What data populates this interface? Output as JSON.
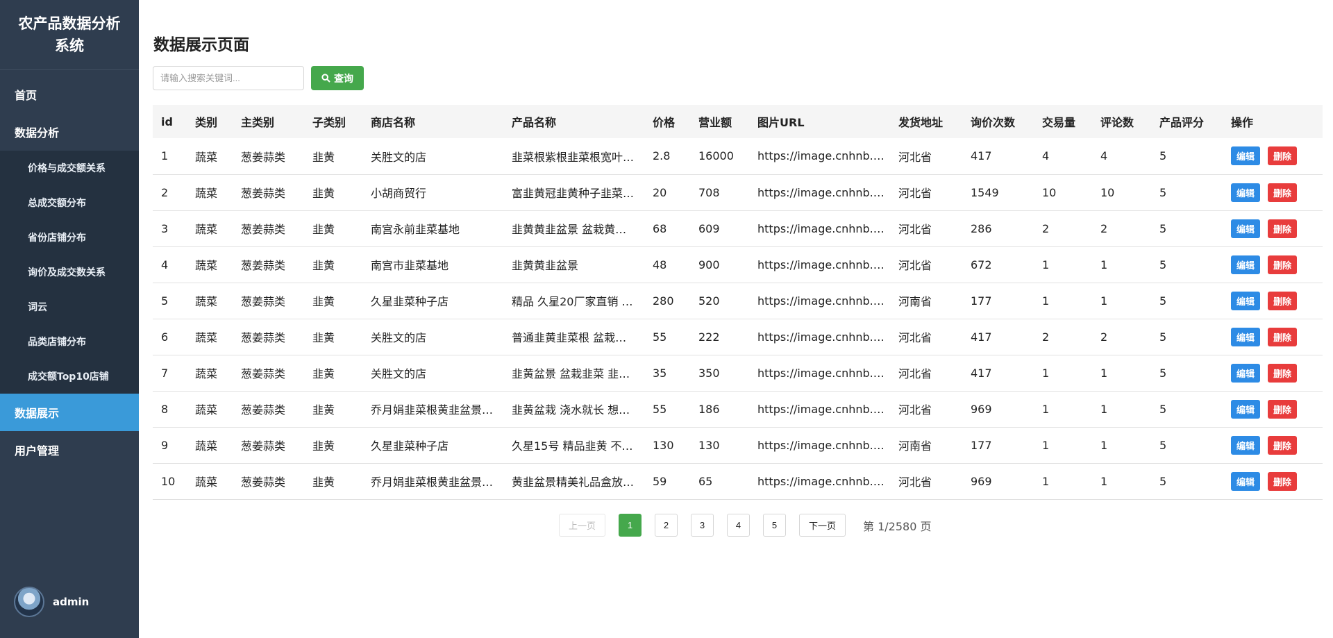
{
  "app": {
    "title": "农产品数据分析系统"
  },
  "sidebar": {
    "items": [
      {
        "label": "首页"
      },
      {
        "label": "数据分析"
      },
      {
        "label": "价格与成交额关系"
      },
      {
        "label": "总成交额分布"
      },
      {
        "label": "省份店铺分布"
      },
      {
        "label": "询价及成交数关系"
      },
      {
        "label": "词云"
      },
      {
        "label": "品类店铺分布"
      },
      {
        "label": "成交额Top10店铺"
      },
      {
        "label": "数据展示"
      },
      {
        "label": "用户管理"
      }
    ],
    "active": "数据展示",
    "user": {
      "name": "admin",
      "avatar_icon": "user-avatar-icon"
    }
  },
  "main": {
    "title": "数据展示页面",
    "search": {
      "placeholder": "请输入搜索关键词..."
    },
    "query_button": {
      "label": "查询",
      "icon": "search-icon"
    },
    "table": {
      "headers": [
        "id",
        "类别",
        "主类别",
        "子类别",
        "商店名称",
        "产品名称",
        "价格",
        "营业额",
        "图片URL",
        "发货地址",
        "询价次数",
        "交易量",
        "评论数",
        "产品评分",
        "操作"
      ],
      "rows": [
        [
          "1",
          "蔬菜",
          "葱姜蒜类",
          "韭黄",
          "关胜文的店",
          "韭菜根紫根韭菜根宽叶…",
          "2.8",
          "16000",
          "https://image.cnhnb.…",
          "河北省",
          "417",
          "4",
          "4",
          "5"
        ],
        [
          "2",
          "蔬菜",
          "葱姜蒜类",
          "韭黄",
          "小胡商贸行",
          "富韭黄冠韭黄种子韭菜…",
          "20",
          "708",
          "https://image.cnhnb.…",
          "河北省",
          "1549",
          "10",
          "10",
          "5"
        ],
        [
          "3",
          "蔬菜",
          "葱姜蒜类",
          "韭黄",
          "南宫永前韭菜基地",
          "韭黄黄韭盆景 盆栽黄…",
          "68",
          "609",
          "https://image.cnhnb.…",
          "河北省",
          "286",
          "2",
          "2",
          "5"
        ],
        [
          "4",
          "蔬菜",
          "葱姜蒜类",
          "韭黄",
          "南宫市韭菜基地",
          "韭黄黄韭盆景",
          "48",
          "900",
          "https://image.cnhnb.…",
          "河北省",
          "672",
          "1",
          "1",
          "5"
        ],
        [
          "5",
          "蔬菜",
          "葱姜蒜类",
          "韭黄",
          "久星韭菜种子店",
          "精品 久星20厂家直销 …",
          "280",
          "520",
          "https://image.cnhnb.…",
          "河南省",
          "177",
          "1",
          "1",
          "5"
        ],
        [
          "6",
          "蔬菜",
          "葱姜蒜类",
          "韭黄",
          "关胜文的店",
          "普通韭黄韭菜根 盆栽…",
          "55",
          "222",
          "https://image.cnhnb.…",
          "河北省",
          "417",
          "2",
          "2",
          "5"
        ],
        [
          "7",
          "蔬菜",
          "葱姜蒜类",
          "韭黄",
          "关胜文的店",
          "韭黄盆景 盆栽韭菜 韭…",
          "35",
          "350",
          "https://image.cnhnb.…",
          "河北省",
          "417",
          "1",
          "1",
          "5"
        ],
        [
          "8",
          "蔬菜",
          "葱姜蒜类",
          "韭黄",
          "乔月娟韭菜根黄韭盆景…",
          "韭黄盆栽 浇水就长 想…",
          "55",
          "186",
          "https://image.cnhnb.…",
          "河北省",
          "969",
          "1",
          "1",
          "5"
        ],
        [
          "9",
          "蔬菜",
          "葱姜蒜类",
          "韭黄",
          "久星韭菜种子店",
          "久星15号 精品韭黄 不…",
          "130",
          "130",
          "https://image.cnhnb.…",
          "河南省",
          "177",
          "1",
          "1",
          "5"
        ],
        [
          "10",
          "蔬菜",
          "葱姜蒜类",
          "韭黄",
          "乔月娟韭菜根黄韭盆景…",
          "黄韭盆景精美礼品盒放…",
          "59",
          "65",
          "https://image.cnhnb.…",
          "河北省",
          "969",
          "1",
          "1",
          "5"
        ]
      ],
      "actions": {
        "edit": "编辑",
        "delete": "删除"
      }
    },
    "pagination": {
      "prev": "上一页",
      "pages": [
        "1",
        "2",
        "3",
        "4",
        "5"
      ],
      "current_page": "1",
      "next": "下一页",
      "info": "第 1/2580 页"
    }
  },
  "colors": {
    "sidebar": "#2f3d4f",
    "sidebar_sub": "#243140",
    "active": "#3a9ad9",
    "primary_green": "#45a84c",
    "edit_blue": "#2d8be5",
    "delete_red": "#e83c3c"
  }
}
